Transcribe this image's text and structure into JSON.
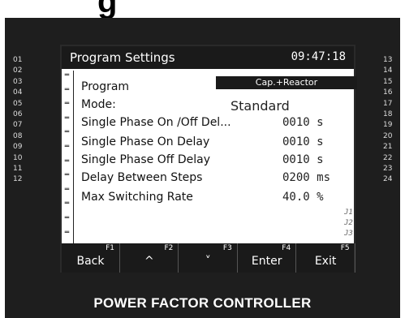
{
  "clipped_heading": "g",
  "screen": {
    "title": "Program Settings",
    "clock": "09:47:18",
    "selected_value": "Cap.+Reactor",
    "rows": [
      {
        "label": "Program",
        "value": ""
      },
      {
        "label": "Mode:",
        "value": "Standard"
      },
      {
        "label": "Single Phase On /Off Del...",
        "value": "0010 s"
      },
      {
        "label": "Single Phase On Delay",
        "value": "0010 s"
      },
      {
        "label": "Single Phase Off Delay",
        "value": "0010 s"
      },
      {
        "label": "Delay Between Steps",
        "value": "0200 ms"
      },
      {
        "label": "Max Switching Rate",
        "value": "40.0 %"
      }
    ],
    "side_tags": [
      "J1",
      "J2",
      "J3"
    ]
  },
  "function_keys": [
    {
      "key": "F1",
      "label": "Back"
    },
    {
      "key": "F2",
      "label": "^"
    },
    {
      "key": "F3",
      "label": "˅"
    },
    {
      "key": "F4",
      "label": "Enter"
    },
    {
      "key": "F5",
      "label": "Exit"
    }
  ],
  "left_numbers": [
    "01",
    "02",
    "03",
    "04",
    "05",
    "06",
    "07",
    "08",
    "09",
    "10",
    "11",
    "12"
  ],
  "right_numbers": [
    "13",
    "14",
    "15",
    "16",
    "17",
    "18",
    "19",
    "20",
    "21",
    "22",
    "23",
    "24"
  ],
  "footer": "POWER FACTOR CONTROLLER"
}
